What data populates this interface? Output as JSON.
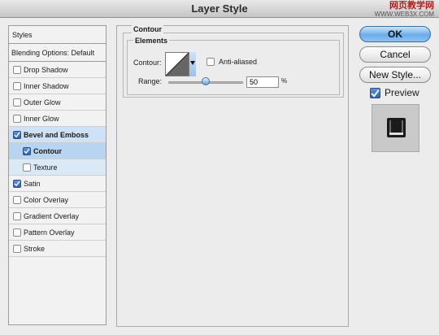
{
  "window": {
    "title": "Layer Style"
  },
  "watermark": {
    "line1": "网页教学网",
    "line2": "WWW.WEB3X.COM"
  },
  "styles_panel": {
    "header": "Styles",
    "blending": "Blending Options: Default",
    "items": [
      {
        "label": "Drop Shadow",
        "checked": false
      },
      {
        "label": "Inner Shadow",
        "checked": false
      },
      {
        "label": "Outer Glow",
        "checked": false
      },
      {
        "label": "Inner Glow",
        "checked": false
      },
      {
        "label": "Bevel and Emboss",
        "checked": true
      },
      {
        "label": "Contour",
        "checked": true
      },
      {
        "label": "Texture",
        "checked": false
      },
      {
        "label": "Satin",
        "checked": true
      },
      {
        "label": "Color Overlay",
        "checked": false
      },
      {
        "label": "Gradient Overlay",
        "checked": false
      },
      {
        "label": "Pattern Overlay",
        "checked": false
      },
      {
        "label": "Stroke",
        "checked": false
      }
    ]
  },
  "contour_panel": {
    "group_title": "Contour",
    "elements_title": "Elements",
    "contour_label": "Contour:",
    "anti_aliased_label": "Anti-aliased",
    "anti_aliased": false,
    "range_label": "Range:",
    "range_value": "50",
    "range_fraction": 0.5,
    "range_unit": "%"
  },
  "buttons": {
    "ok": "OK",
    "cancel": "Cancel",
    "new_style": "New Style..."
  },
  "preview": {
    "label": "Preview",
    "checked": true
  },
  "colors": {
    "selection": "#b9d4f1",
    "accent": "#2e63b3"
  }
}
